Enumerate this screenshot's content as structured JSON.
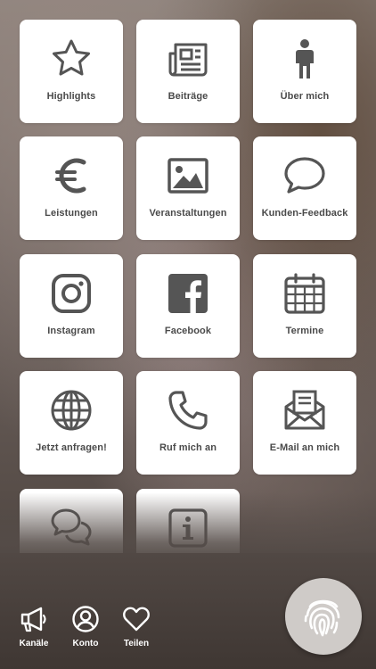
{
  "tiles": [
    {
      "label": "Highlights",
      "icon": "star-icon"
    },
    {
      "label": "Beiträge",
      "icon": "newspaper-icon"
    },
    {
      "label": "Über mich",
      "icon": "person-icon"
    },
    {
      "label": "Leistungen",
      "icon": "euro-icon"
    },
    {
      "label": "Veranstaltungen",
      "icon": "image-icon"
    },
    {
      "label": "Kunden-Feedback",
      "icon": "speech-bubble-icon"
    },
    {
      "label": "Instagram",
      "icon": "instagram-icon"
    },
    {
      "label": "Facebook",
      "icon": "facebook-icon"
    },
    {
      "label": "Termine",
      "icon": "calendar-icon"
    },
    {
      "label": "Jetzt anfragen!",
      "icon": "globe-icon"
    },
    {
      "label": "Ruf mich an",
      "icon": "phone-icon"
    },
    {
      "label": "E-Mail an mich",
      "icon": "mail-icon"
    },
    {
      "label": "",
      "icon": "chat-bubbles-icon"
    },
    {
      "label": "",
      "icon": "info-icon"
    }
  ],
  "nav": {
    "channels": {
      "label": "Kanäle",
      "icon": "megaphone-icon"
    },
    "account": {
      "label": "Konto",
      "icon": "user-circle-icon"
    },
    "share": {
      "label": "Teilen",
      "icon": "heart-icon"
    }
  },
  "fingerprint": {
    "icon": "fingerprint-icon"
  },
  "colors": {
    "icon": "#555555",
    "tile": "#ffffff",
    "nav_text": "#ffffff"
  }
}
